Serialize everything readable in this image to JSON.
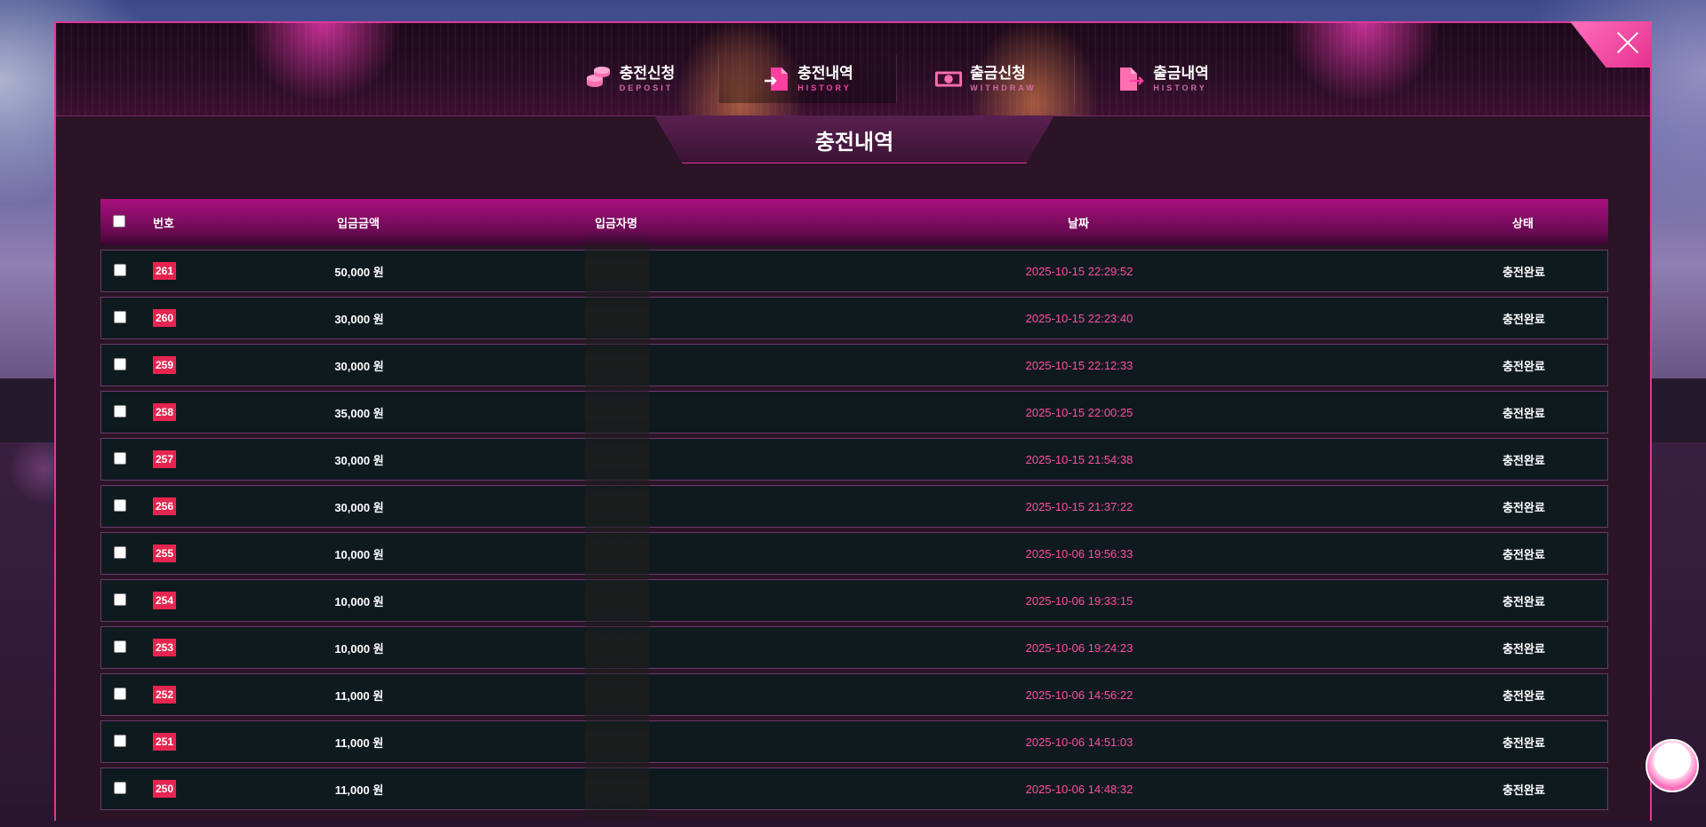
{
  "tabs": [
    {
      "label": "충전신청",
      "sub": "DEPOSIT",
      "icon": "coins-icon",
      "active": false
    },
    {
      "label": "충전내역",
      "sub": "HISTORY",
      "icon": "document-import-icon",
      "active": true
    },
    {
      "label": "출금신청",
      "sub": "WITHDRAW",
      "icon": "cash-icon",
      "active": false
    },
    {
      "label": "출금내역",
      "sub": "HISTORY",
      "icon": "document-export-icon",
      "active": false
    }
  ],
  "page_title": "충전내역",
  "table": {
    "headers": {
      "number": "번호",
      "amount": "입금금액",
      "depositor": "입금자명",
      "date": "날짜",
      "status": "상태"
    },
    "rows": [
      {
        "no": "261",
        "amount": "50,000 원",
        "date": "2025-10-15 22:29:52",
        "status": "충전완료"
      },
      {
        "no": "260",
        "amount": "30,000 원",
        "date": "2025-10-15 22:23:40",
        "status": "충전완료"
      },
      {
        "no": "259",
        "amount": "30,000 원",
        "date": "2025-10-15 22:12:33",
        "status": "충전완료"
      },
      {
        "no": "258",
        "amount": "35,000 원",
        "date": "2025-10-15 22:00:25",
        "status": "충전완료"
      },
      {
        "no": "257",
        "amount": "30,000 원",
        "date": "2025-10-15 21:54:38",
        "status": "충전완료"
      },
      {
        "no": "256",
        "amount": "30,000 원",
        "date": "2025-10-15 21:37:22",
        "status": "충전완료"
      },
      {
        "no": "255",
        "amount": "10,000 원",
        "date": "2025-10-06 19:56:33",
        "status": "충전완료"
      },
      {
        "no": "254",
        "amount": "10,000 원",
        "date": "2025-10-06 19:33:15",
        "status": "충전완료"
      },
      {
        "no": "253",
        "amount": "10,000 원",
        "date": "2025-10-06 19:24:23",
        "status": "충전완료"
      },
      {
        "no": "252",
        "amount": "11,000 원",
        "date": "2025-10-06 14:56:22",
        "status": "충전완료"
      },
      {
        "no": "251",
        "amount": "11,000 원",
        "date": "2025-10-06 14:51:03",
        "status": "충전완료"
      },
      {
        "no": "250",
        "amount": "11,000 원",
        "date": "2025-10-06 14:48:32",
        "status": "충전완료"
      }
    ]
  },
  "colors": {
    "accent": "#e0379b",
    "number_badge": "#e52550",
    "date_text": "#ff4f9d",
    "row_bg": "#0f1a1f"
  }
}
